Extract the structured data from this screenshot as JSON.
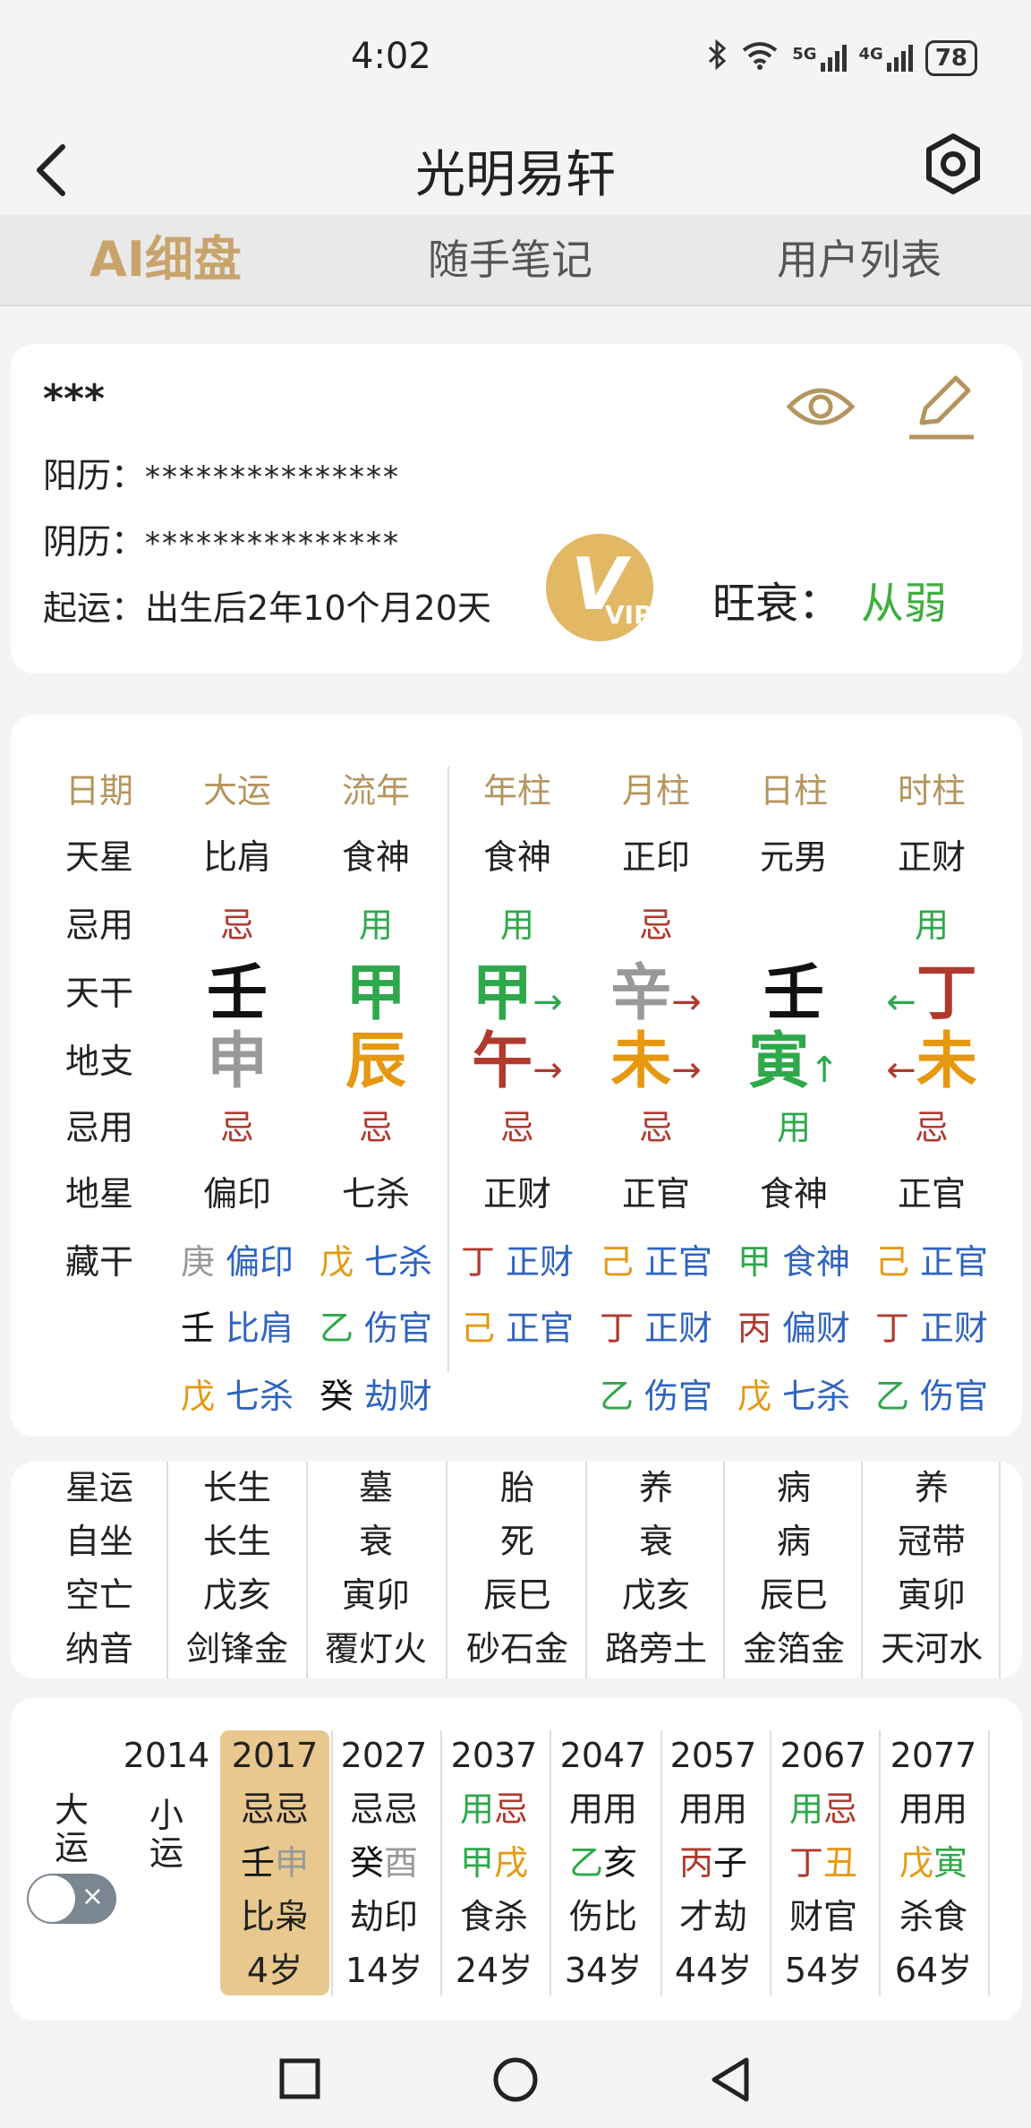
{
  "status": {
    "time": "4:02",
    "signal_a": "5G",
    "signal_b": "4G",
    "battery": "78"
  },
  "header": {
    "title": "光明易轩"
  },
  "tabs": [
    "AI细盘",
    "随手笔记",
    "用户列表"
  ],
  "profile": {
    "name": "***",
    "solar_label": "阳历：",
    "solar_value": "***************",
    "lunar_label": "阴历：",
    "lunar_value": "***************",
    "qiyun_label": "起运：",
    "qiyun_value": "出生后2年10个月20天",
    "wangshuai_label": "旺衰：",
    "wangshuai_value": "从弱",
    "vip_text": "VIP"
  },
  "chart": {
    "row_labels": [
      "日期",
      "天星",
      "忌用",
      "天干",
      "地支",
      "忌用",
      "地星",
      "藏干"
    ],
    "columns": [
      {
        "header": "大运",
        "tianxing": "比肩",
        "jiyong1": "忌",
        "tiangan": "壬",
        "dizhi": "申",
        "jiyong2": "忌",
        "dixing": "偏印",
        "canggan": [
          [
            "庚",
            "偏印"
          ],
          [
            "壬",
            "比肩"
          ],
          [
            "戊",
            "七杀"
          ]
        ]
      },
      {
        "header": "流年",
        "tianxing": "食神",
        "jiyong1": "用",
        "tiangan": "甲",
        "dizhi": "辰",
        "jiyong2": "忌",
        "dixing": "七杀",
        "canggan": [
          [
            "戊",
            "七杀"
          ],
          [
            "乙",
            "伤官"
          ],
          [
            "癸",
            "劫财"
          ]
        ]
      },
      {
        "header": "年柱",
        "tianxing": "食神",
        "jiyong1": "用",
        "tiangan": "甲",
        "dizhi": "午",
        "jiyong2": "忌",
        "dixing": "正财",
        "canggan": [
          [
            "丁",
            "正财"
          ],
          [
            "己",
            "正官"
          ]
        ]
      },
      {
        "header": "月柱",
        "tianxing": "正印",
        "jiyong1": "忌",
        "tiangan": "辛",
        "dizhi": "未",
        "jiyong2": "忌",
        "dixing": "正官",
        "canggan": [
          [
            "己",
            "正官"
          ],
          [
            "丁",
            "正财"
          ],
          [
            "乙",
            "伤官"
          ]
        ]
      },
      {
        "header": "日柱",
        "tianxing": "元男",
        "jiyong1": "",
        "tiangan": "壬",
        "dizhi": "寅",
        "jiyong2": "用",
        "dixing": "食神",
        "canggan": [
          [
            "甲",
            "食神"
          ],
          [
            "丙",
            "偏财"
          ],
          [
            "戊",
            "七杀"
          ]
        ]
      },
      {
        "header": "时柱",
        "tianxing": "正财",
        "jiyong1": "用",
        "tiangan": "丁",
        "dizhi": "未",
        "jiyong2": "忌",
        "dixing": "正官",
        "canggan": [
          [
            "己",
            "正官"
          ],
          [
            "丁",
            "正财"
          ],
          [
            "乙",
            "伤官"
          ]
        ]
      }
    ],
    "arrows": {
      "right": "→",
      "left": "←",
      "up": "↑"
    }
  },
  "table2": {
    "labels": [
      "星运",
      "自坐",
      "空亡",
      "纳音"
    ],
    "columns": [
      [
        "长生",
        "长生",
        "戊亥",
        "剑锋金"
      ],
      [
        "墓",
        "衰",
        "寅卯",
        "覆灯火"
      ],
      [
        "胎",
        "死",
        "辰巳",
        "砂石金"
      ],
      [
        "养",
        "衰",
        "戊亥",
        "路旁土"
      ],
      [
        "病",
        "病",
        "辰巳",
        "金箔金"
      ],
      [
        "养",
        "冠带",
        "寅卯",
        "天河水"
      ]
    ]
  },
  "dayun": {
    "label_dayun": "大运",
    "label_xiaoyun": "小运",
    "first_year": "2014",
    "columns": [
      {
        "year": "2017",
        "jy": "忌忌",
        "gz1": "壬",
        "gz2": "申",
        "ss": "比枭",
        "age": "4岁"
      },
      {
        "year": "2027",
        "jy": "忌忌",
        "gz1": "癸",
        "gz2": "酉",
        "ss": "劫印",
        "age": "14岁"
      },
      {
        "year": "2037",
        "jy": "用忌",
        "gz1": "甲",
        "gz2": "戌",
        "ss": "食杀",
        "age": "24岁"
      },
      {
        "year": "2047",
        "jy": "用用",
        "gz1": "乙",
        "gz2": "亥",
        "ss": "伤比",
        "age": "34岁"
      },
      {
        "year": "2057",
        "jy": "用用",
        "gz1": "丙",
        "gz2": "子",
        "ss": "才劫",
        "age": "44岁"
      },
      {
        "year": "2067",
        "jy": "用忌",
        "gz1": "丁",
        "gz2": "丑",
        "ss": "财官",
        "age": "54岁"
      },
      {
        "year": "2077",
        "jy": "用用",
        "gz1": "戊",
        "gz2": "寅",
        "ss": "杀食",
        "age": "64岁"
      }
    ],
    "toggle_symbol": "×"
  }
}
